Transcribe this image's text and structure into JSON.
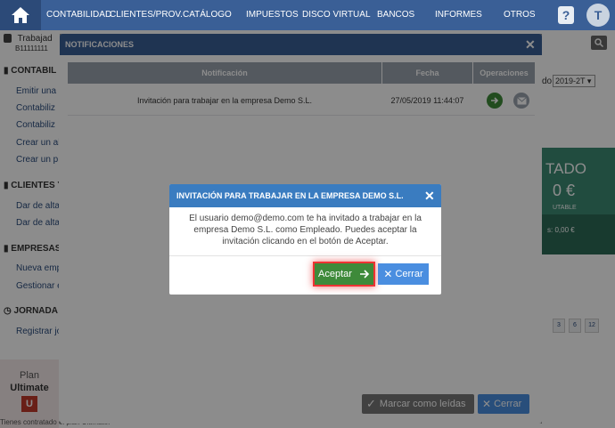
{
  "topnav": {
    "items": [
      "CONTABILIDAD",
      "CLIENTES/PROV.",
      "CATÁLOGO",
      "IMPUESTOS",
      "DISCO VIRTUAL",
      "BANCOS",
      "INFORMES",
      "OTROS"
    ],
    "help_label": "?",
    "avatar_letter": "T",
    "icons": {
      "home": "home-icon"
    }
  },
  "sidebar": {
    "user_name": "Trabajad",
    "user_id": "B11111111",
    "sections": [
      {
        "title": "CONTABIL",
        "links": [
          "Emitir una",
          "Contabiliz",
          "Contabiliz",
          "Crear un al",
          "Crear un p"
        ]
      },
      {
        "title": "CLIENTES Y",
        "links": [
          "Dar de alta",
          "Dar de alta"
        ]
      },
      {
        "title": "EMPRESAS",
        "links": [
          "Nueva empr",
          "Gestionar e"
        ]
      },
      {
        "title": "JORNADA L",
        "links": [
          "Registrar jo"
        ]
      }
    ],
    "plan": {
      "label": "Plan",
      "name": "Ultimate",
      "badge": "U",
      "footer": "Tienes contratado el plan Ultimate."
    }
  },
  "background": {
    "period_label": "do",
    "period_value": "2019-2T",
    "panel_title": "TADO",
    "panel_amount": "0 €",
    "panel_caption": "UTABLE",
    "panel_total": "s: 0,00 €",
    "pager": [
      "3",
      "6",
      "12"
    ]
  },
  "notifications": {
    "title": "NOTIFICACIONES",
    "columns": [
      "Notificación",
      "Fecha",
      "Operaciones"
    ],
    "rows": [
      {
        "text": "Invitación para trabajar en la empresa Demo S.L.",
        "date": "27/05/2019 11:44:07"
      }
    ],
    "mark_read_label": "Marcar como leídas",
    "close_label": "Cerrar"
  },
  "invite": {
    "title": "INVITACIÓN PARA TRABAJAR EN LA EMPRESA DEMO S.L.",
    "body": "El usuario demo@demo.com te ha invitado a trabajar en la empresa Demo S.L. como Empleado. Puedes aceptar la invitación clicando en el botón de Aceptar.",
    "accept_label": "Aceptar",
    "close_label": "Cerrar"
  },
  "colors": {
    "nav": "#3a5f96",
    "accept": "#3e8a3a",
    "close": "#4a8ee0",
    "highlight": "#e33333"
  }
}
